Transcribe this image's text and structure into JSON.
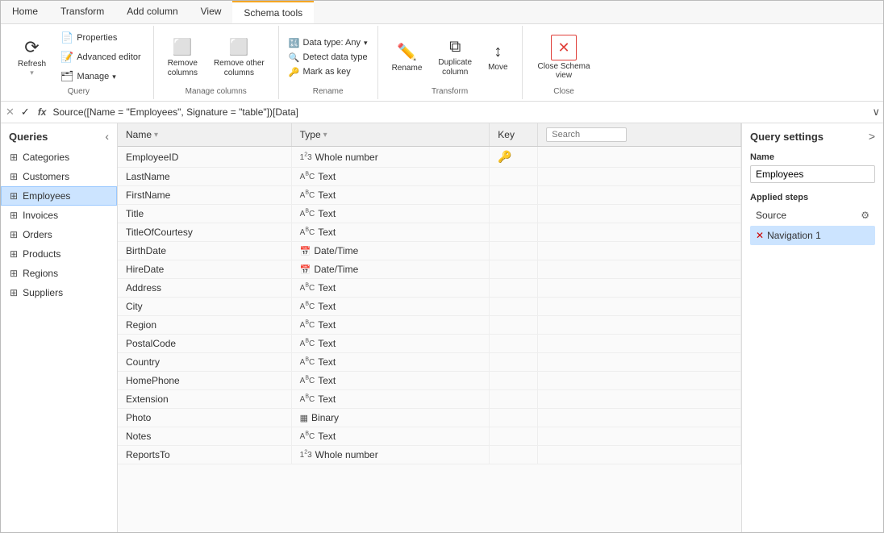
{
  "ribbon": {
    "tabs": [
      {
        "label": "Home",
        "active": false
      },
      {
        "label": "Transform",
        "active": false
      },
      {
        "label": "Add column",
        "active": false
      },
      {
        "label": "View",
        "active": false
      },
      {
        "label": "Schema tools",
        "active": true
      }
    ],
    "groups": {
      "query": {
        "label": "Query",
        "refresh": "Refresh",
        "properties": "Properties",
        "advanced_editor": "Advanced editor",
        "manage": "Manage"
      },
      "manage_columns": {
        "label": "Manage columns",
        "remove_columns": "Remove\ncolumns",
        "remove_other": "Remove other\ncolumns"
      },
      "transform": {
        "label": "Transform",
        "data_type": "Data type: Any",
        "detect_data_type": "Detect data type",
        "mark_as_key": "Mark as key"
      },
      "actions": {
        "rename": "Rename",
        "duplicate_column": "Duplicate\ncolumn",
        "move": "Move"
      },
      "close": {
        "label": "Close",
        "close_schema_view": "Close Schema\nview"
      }
    }
  },
  "formula_bar": {
    "cancel_icon": "✕",
    "confirm_icon": "✓",
    "fx": "fx",
    "formula": "Source([Name = \"Employees\", Signature = \"table\"])[Data]",
    "expand_icon": "∨"
  },
  "queries": {
    "title": "Queries",
    "items": [
      {
        "label": "Categories",
        "active": false
      },
      {
        "label": "Customers",
        "active": false
      },
      {
        "label": "Employees",
        "active": true
      },
      {
        "label": "Invoices",
        "active": false
      },
      {
        "label": "Orders",
        "active": false
      },
      {
        "label": "Products",
        "active": false
      },
      {
        "label": "Regions",
        "active": false
      },
      {
        "label": "Suppliers",
        "active": false
      }
    ]
  },
  "grid": {
    "columns": {
      "name": "Name",
      "type": "Type",
      "key": "Key",
      "search_placeholder": "Search"
    },
    "rows": [
      {
        "name": "EmployeeID",
        "type": "Whole number",
        "type_icon": "123",
        "has_key": true
      },
      {
        "name": "LastName",
        "type": "Text",
        "type_icon": "ABC",
        "has_key": false
      },
      {
        "name": "FirstName",
        "type": "Text",
        "type_icon": "ABC",
        "has_key": false
      },
      {
        "name": "Title",
        "type": "Text",
        "type_icon": "ABC",
        "has_key": false
      },
      {
        "name": "TitleOfCourtesy",
        "type": "Text",
        "type_icon": "ABC",
        "has_key": false
      },
      {
        "name": "BirthDate",
        "type": "Date/Time",
        "type_icon": "DT",
        "has_key": false
      },
      {
        "name": "HireDate",
        "type": "Date/Time",
        "type_icon": "DT",
        "has_key": false
      },
      {
        "name": "Address",
        "type": "Text",
        "type_icon": "ABC",
        "has_key": false
      },
      {
        "name": "City",
        "type": "Text",
        "type_icon": "ABC",
        "has_key": false
      },
      {
        "name": "Region",
        "type": "Text",
        "type_icon": "ABC",
        "has_key": false
      },
      {
        "name": "PostalCode",
        "type": "Text",
        "type_icon": "ABC",
        "has_key": false
      },
      {
        "name": "Country",
        "type": "Text",
        "type_icon": "ABC",
        "has_key": false
      },
      {
        "name": "HomePhone",
        "type": "Text",
        "type_icon": "ABC",
        "has_key": false
      },
      {
        "name": "Extension",
        "type": "Text",
        "type_icon": "ABC",
        "has_key": false
      },
      {
        "name": "Photo",
        "type": "Binary",
        "type_icon": "BIN",
        "has_key": false
      },
      {
        "name": "Notes",
        "type": "Text",
        "type_icon": "ABC",
        "has_key": false
      },
      {
        "name": "ReportsTo",
        "type": "Whole number",
        "type_icon": "123",
        "has_key": false
      }
    ]
  },
  "query_settings": {
    "title": "Query settings",
    "expand_icon": ">",
    "name_label": "Name",
    "name_value": "Employees",
    "applied_steps_label": "Applied steps",
    "steps": [
      {
        "label": "Source",
        "active": false,
        "has_gear": true,
        "has_delete": false
      },
      {
        "label": "Navigation 1",
        "active": true,
        "has_gear": false,
        "has_delete": true
      }
    ]
  }
}
